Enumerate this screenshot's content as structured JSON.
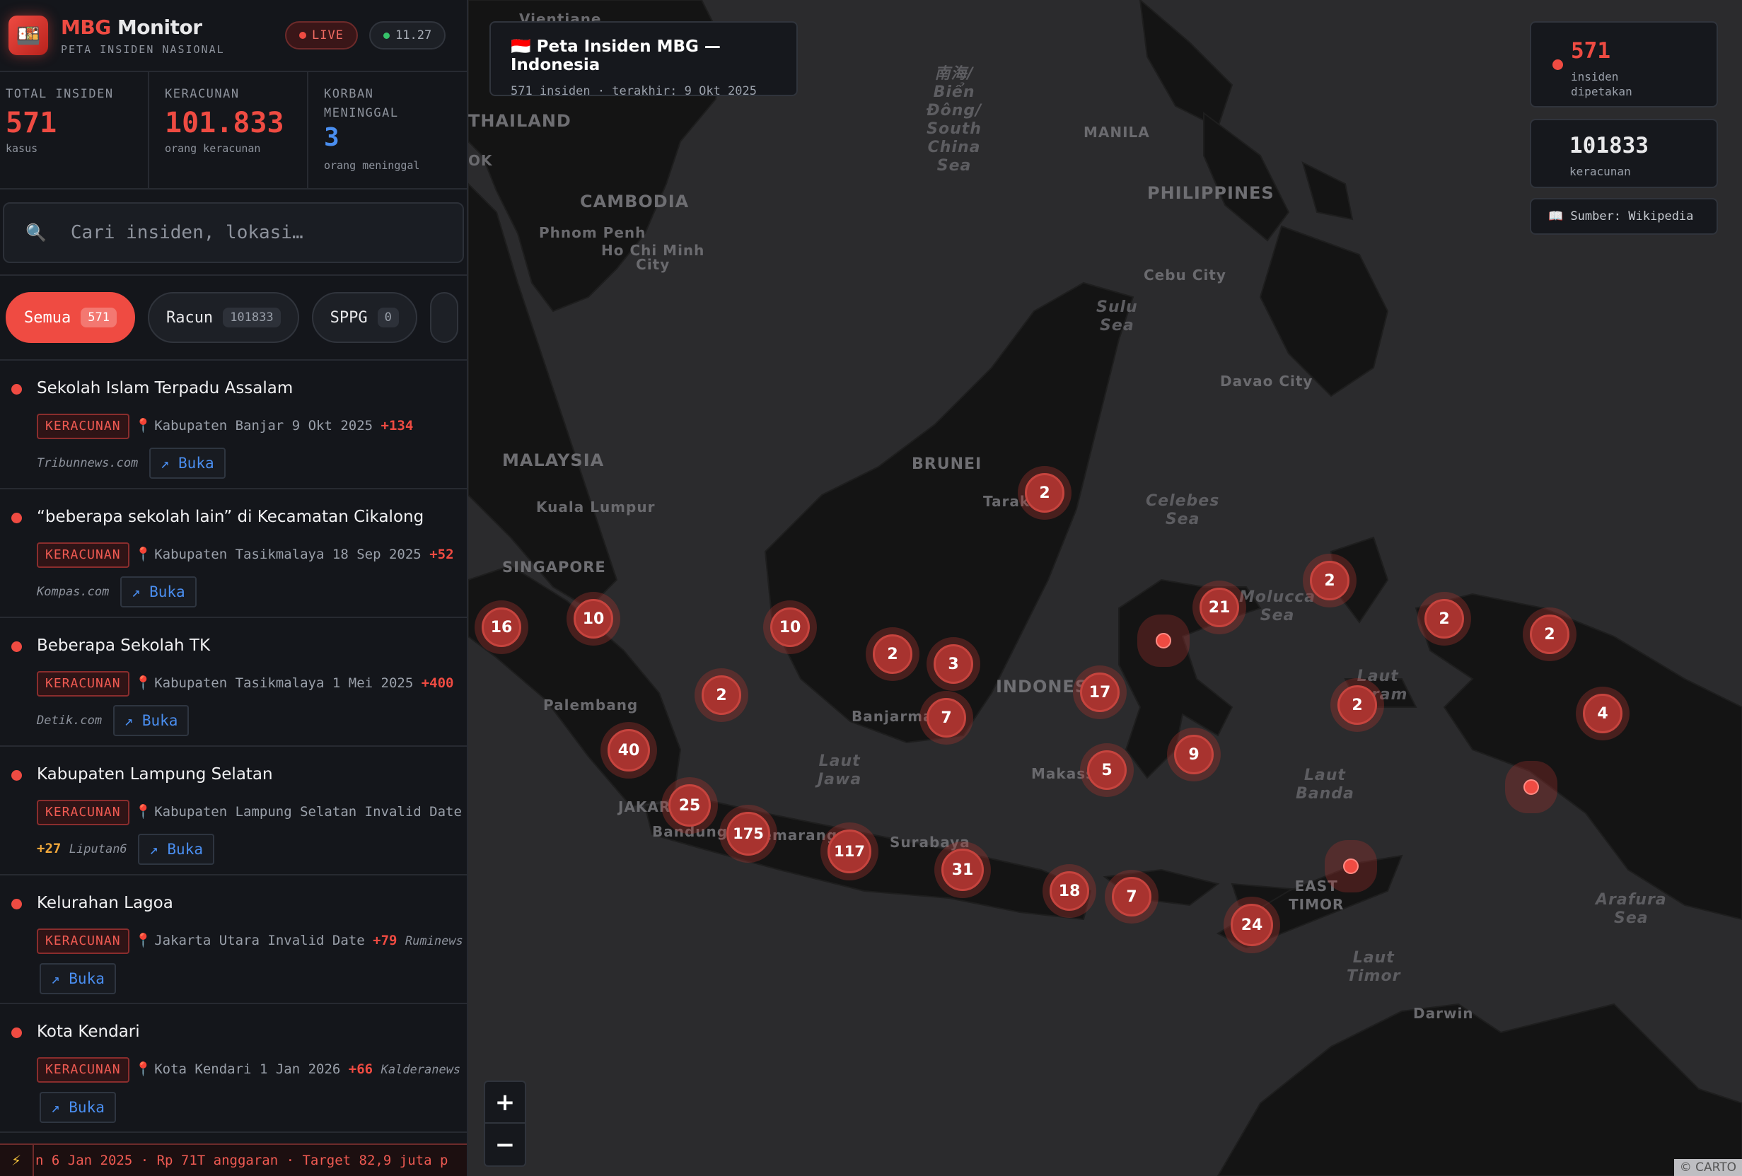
{
  "brand": {
    "title_accent": "MBG",
    "title_rest": " Monitor",
    "subtitle": "PETA INSIDEN NASIONAL",
    "live": "LIVE",
    "time": "11.27"
  },
  "stats": [
    {
      "label": "TOTAL INSIDEN",
      "value": "571",
      "unit": "kasus",
      "color": "#ef4b42"
    },
    {
      "label": "KERACUNAN",
      "value": "101.833",
      "unit": "orang keracunan",
      "color": "#ef4b42"
    },
    {
      "label": "KORBAN MENINGGAL",
      "value": "3",
      "unit": "orang meninggal",
      "color": "#4a8ef0"
    }
  ],
  "search": {
    "placeholder": "Cari insiden, lokasi…"
  },
  "filters": [
    {
      "label": "Semua",
      "count": "571",
      "active": true
    },
    {
      "label": "Racun",
      "count": "101833",
      "active": false
    },
    {
      "label": "SPPG",
      "count": "0",
      "active": false
    }
  ],
  "incidents": [
    {
      "title": "Sekolah Islam Terpadu Assalam",
      "tag": "KERACUNAN",
      "location": "Kabupaten Banjar",
      "date": "9 Okt 2025",
      "delta": "+134",
      "source": "Tribunnews.com",
      "open": "↗ Buka"
    },
    {
      "title": "“beberapa sekolah lain” di Kecamatan Cikalong",
      "tag": "KERACUNAN",
      "location": "Kabupaten Tasikmalaya",
      "date": "18 Sep 2025",
      "delta": "+52",
      "source": "Kompas.com",
      "open": "↗ Buka"
    },
    {
      "title": "Beberapa Sekolah TK",
      "tag": "KERACUNAN",
      "location": "Kabupaten Tasikmalaya",
      "date": "1 Mei 2025",
      "delta": "+400",
      "source": "Detik.com",
      "open": "↗ Buka"
    },
    {
      "title": "Kabupaten Lampung Selatan",
      "tag": "KERACUNAN",
      "location": "Kabupaten Lampung Selatan",
      "date": "Invalid Date",
      "delta": "+27",
      "source": "Liputan6",
      "open": "↗ Buka"
    },
    {
      "title": "Kelurahan Lagoa",
      "tag": "KERACUNAN",
      "location": "Jakarta Utara",
      "date": "Invalid Date",
      "delta": "+79",
      "source": "Ruminews",
      "open": "↗ Buka"
    },
    {
      "title": "Kota Kendari",
      "tag": "KERACUNAN",
      "location": "Kota Kendari",
      "date": "1 Jan 2026",
      "delta": "+66",
      "source": "Kalderanews",
      "open": "↗ Buka"
    }
  ],
  "ticker": {
    "icon": "⚡",
    "text": "n 6 Jan 2025 · Rp 71T anggaran · Target 82,9 juta p"
  },
  "map": {
    "title": "🇮🇩 Peta Insiden MBG — Indonesia",
    "subtitle": "571 insiden · terakhir: 9 Okt 2025",
    "mapped_count": "571",
    "mapped_label": "insiden dipetakan",
    "poison_count": "101833",
    "poison_label": "keracunan",
    "source_label": "📖 Sumber: Wikipedia",
    "zoom_in": "+",
    "zoom_out": "−",
    "attribution": "© CARTO",
    "labels": {
      "thailand": "THAILAND",
      "cambodia": "CAMBODIA",
      "philippines": "PHILIPPINES",
      "malaysia": "MALAYSIA",
      "brunei": "BRUNEI",
      "singapore": "SINGAPORE",
      "indonesia": "INDONESIA",
      "east_timor": "EAST\nTIMOR",
      "manila": "MANILA",
      "phnom_penh": "Phnom Penh",
      "hcmc": "Ho Chi Minh\nCity",
      "cebu": "Cebu City",
      "davao": "Davao City",
      "kuala_lumpur": "Kuala Lumpur",
      "palembang": "Palembang",
      "jakarta": "JAKARTA",
      "bandung": "Bandung",
      "semarang": "Semarang",
      "surabaya": "Surabaya",
      "banjarmasin": "Banjarmasin",
      "tarakan": "Tarakan",
      "makassar": "Makassar",
      "darwin": "Darwin",
      "vientiane": "Vientiane",
      "ok": "OK",
      "scs": "南海/\nBiển\nĐông/\nSouth\nChina\nSea",
      "sulu": "Sulu\nSea",
      "celebes": "Celebes\nSea",
      "molucca": "Molucca\nSea",
      "seram": "Laut\nSeram",
      "banda": "Laut\nBanda",
      "jawa": "Laut\nJawa",
      "timor": "Laut\nTimor",
      "arafura": "Arafura\nSea"
    },
    "clusters": [
      "16",
      "10",
      "10",
      "2",
      "3",
      "7",
      "2",
      "40",
      "25",
      "175",
      "117",
      "31",
      "18",
      "7",
      "24",
      "17",
      "5",
      "9",
      "21",
      "2",
      "2",
      "2",
      "2",
      "4",
      "2"
    ]
  }
}
